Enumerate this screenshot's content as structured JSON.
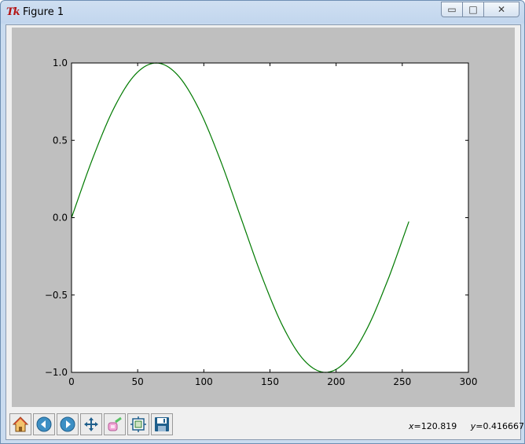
{
  "window": {
    "title": "Figure 1",
    "app_icon": "tk-feather-icon",
    "app_icon_text": "Tk",
    "controls": [
      {
        "name": "minimize",
        "glyph": "▭"
      },
      {
        "name": "maximize",
        "glyph": "□"
      },
      {
        "name": "close",
        "glyph": "✕"
      }
    ]
  },
  "toolbar": {
    "buttons": [
      {
        "name": "home",
        "icon": "home-icon"
      },
      {
        "name": "back",
        "icon": "back-arrow-icon"
      },
      {
        "name": "forward",
        "icon": "forward-arrow-icon"
      },
      {
        "name": "pan",
        "icon": "pan-arrows-icon"
      },
      {
        "name": "zoom",
        "icon": "zoom-rect-icon"
      },
      {
        "name": "subplots",
        "icon": "subplots-config-icon"
      },
      {
        "name": "save",
        "icon": "floppy-save-icon"
      }
    ],
    "coords": {
      "x_label": "x",
      "x_value": "120.819",
      "y_label": "y",
      "y_value": "0.416667"
    }
  },
  "colors": {
    "figure_bg": "#bfbfbf",
    "axes_bg": "#ffffff",
    "line": "#007a00",
    "chrome": "#c9dbef"
  },
  "chart_data": {
    "type": "line",
    "title": "",
    "xlabel": "",
    "ylabel": "",
    "xlim": [
      0,
      300
    ],
    "ylim": [
      -1.0,
      1.0
    ],
    "xticks": [
      0,
      50,
      100,
      150,
      200,
      250,
      300
    ],
    "yticks": [
      -1.0,
      -0.5,
      0.0,
      0.5,
      1.0
    ],
    "xtick_labels": [
      "0",
      "50",
      "100",
      "150",
      "200",
      "250",
      "300"
    ],
    "ytick_labels": [
      "−1.0",
      "−0.5",
      "0.0",
      "0.5",
      "1.0"
    ],
    "grid": false,
    "series": [
      {
        "color": "#007a00",
        "x": [
          0,
          16,
          32,
          48,
          64,
          80,
          96,
          112,
          128,
          144,
          160,
          176,
          192,
          208,
          224,
          240,
          255
        ],
        "y": [
          0.0,
          0.383,
          0.707,
          0.924,
          1.0,
          0.924,
          0.707,
          0.383,
          0.0,
          -0.383,
          -0.707,
          -0.924,
          -1.0,
          -0.924,
          -0.707,
          -0.383,
          -0.025
        ]
      }
    ]
  }
}
